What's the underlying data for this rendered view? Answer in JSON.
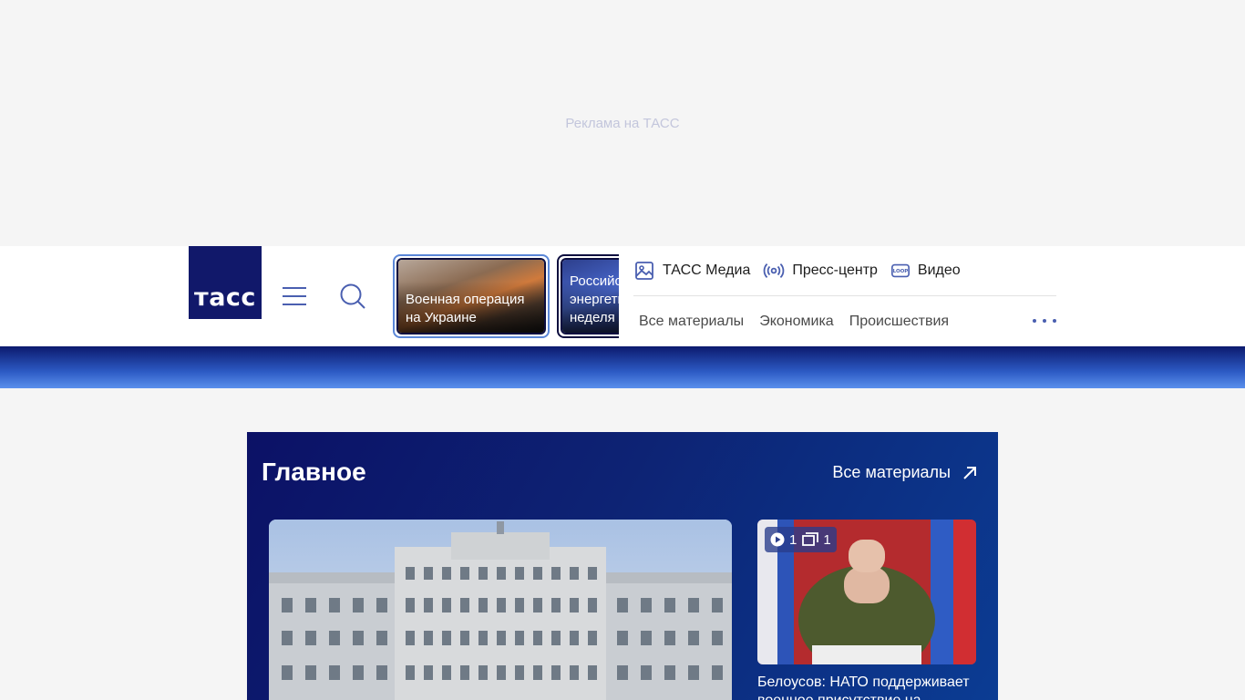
{
  "ad": {
    "label": "Реклама на ТАСС"
  },
  "header": {
    "logo_text": "ТАСС",
    "stories": [
      {
        "title": "Военная операция на Украине"
      },
      {
        "title": "Российская энергетическая неделя"
      }
    ],
    "top_links": [
      {
        "label": "ТАСС Медиа",
        "icon": "image-icon"
      },
      {
        "label": "Пресс-центр",
        "icon": "broadcast-icon"
      },
      {
        "label": "Видео",
        "icon": "loop-video-icon"
      }
    ],
    "sub_nav": [
      {
        "label": "Все материалы"
      },
      {
        "label": "Экономика"
      },
      {
        "label": "Происшествия"
      }
    ]
  },
  "main": {
    "section_title": "Главное",
    "all_materials_label": "Все материалы",
    "side_card": {
      "videos_count": "1",
      "gallery_count": "1",
      "title": "Белоусов: НАТО поддерживает военное присутствие на"
    }
  },
  "colors": {
    "brand": "#11186a",
    "accent": "#4a5fb0",
    "block_bg_start": "#0c1166",
    "block_bg_end": "#0b3c93"
  }
}
